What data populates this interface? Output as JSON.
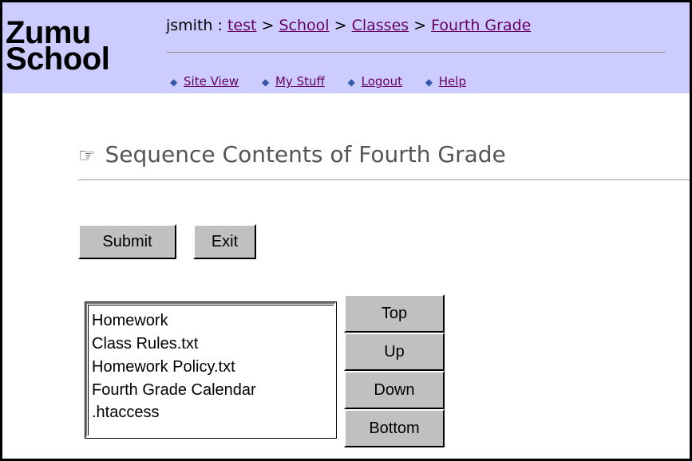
{
  "logo": {
    "line1": "Zumu",
    "line2": "School"
  },
  "breadcrumb": {
    "user": "jsmith",
    "sep_colon": ":",
    "sep": ">",
    "items": [
      "test",
      "School",
      "Classes",
      "Fourth Grade"
    ]
  },
  "nav": [
    {
      "label": "Site View",
      "icon": "diamond-bullet-icon"
    },
    {
      "label": "My Stuff",
      "icon": "diamond-bullet-icon"
    },
    {
      "label": "Logout",
      "icon": "diamond-bullet-icon"
    },
    {
      "label": "Help",
      "icon": "diamond-bullet-icon"
    }
  ],
  "page": {
    "title": "Sequence Contents of Fourth Grade",
    "title_icon": "pointing-hand-icon"
  },
  "form": {
    "submit_label": "Submit",
    "exit_label": "Exit"
  },
  "list": {
    "items": [
      "Homework",
      "Class Rules.txt",
      "Homework Policy.txt",
      "Fourth Grade Calendar",
      ".htaccess"
    ]
  },
  "order_buttons": {
    "top": "Top",
    "up": "Up",
    "down": "Down",
    "bottom": "Bottom"
  },
  "colors": {
    "header_bg": "#ccccff",
    "link": "#660066",
    "button_face": "#c0c0c0"
  }
}
